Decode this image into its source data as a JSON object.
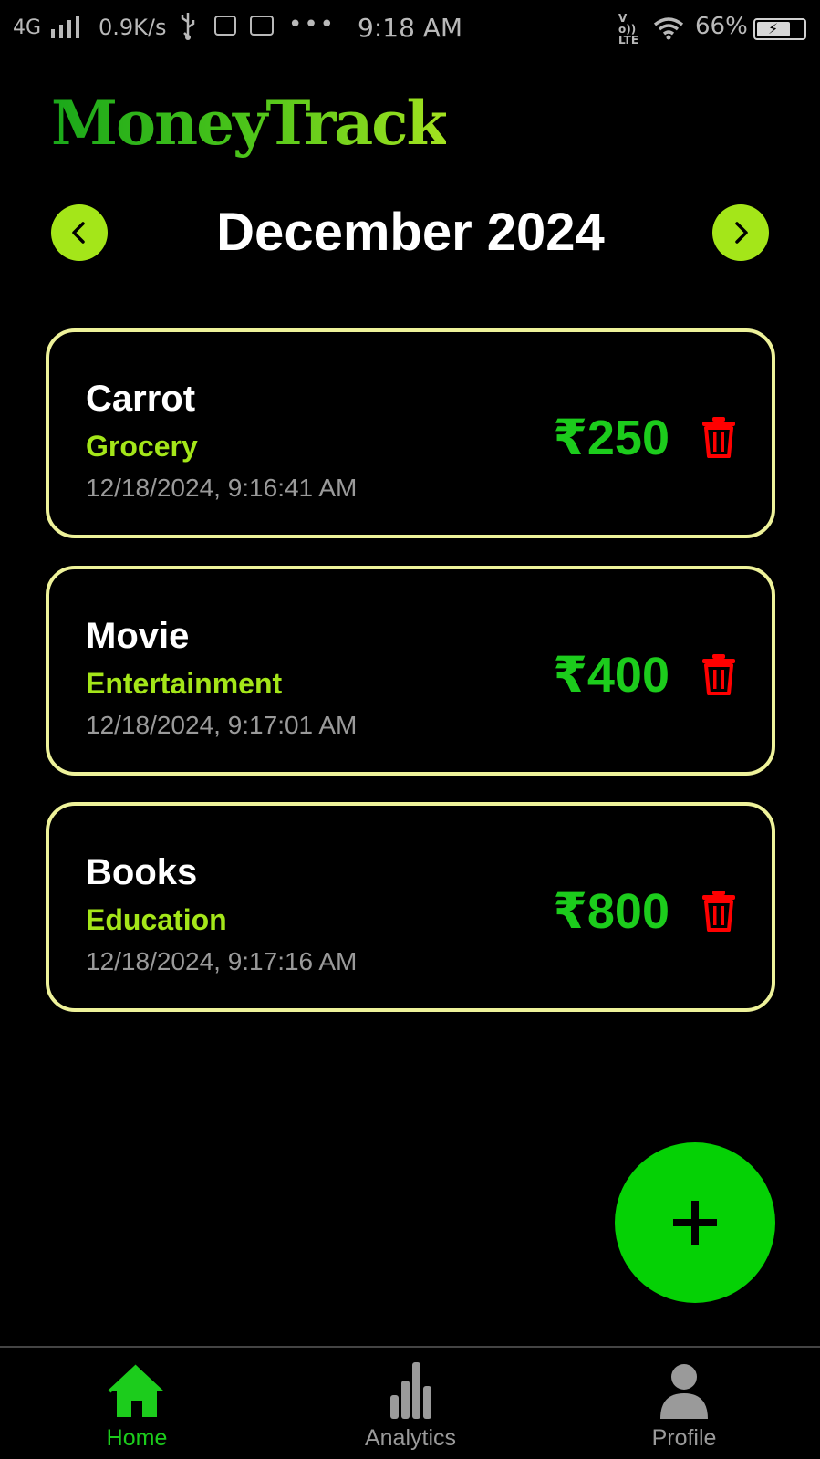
{
  "status_bar": {
    "network": "4G",
    "speed": "0.9K/s",
    "dots": "•••",
    "time": "9:18 AM",
    "volte": "Vo)) LTE",
    "battery": "66%"
  },
  "header": {
    "app_title": "MoneyTrack",
    "month": "December 2024"
  },
  "expenses": [
    {
      "title": "Carrot",
      "category": "Grocery",
      "date": "12/18/2024, 9:16:41 AM",
      "amount": "₹250"
    },
    {
      "title": "Movie",
      "category": "Entertainment",
      "date": "12/18/2024, 9:17:01 AM",
      "amount": "₹400"
    },
    {
      "title": "Books",
      "category": "Education",
      "date": "12/18/2024, 9:17:16 AM",
      "amount": "₹800"
    }
  ],
  "bottom_nav": {
    "home": "Home",
    "analytics": "Analytics",
    "profile": "Profile"
  },
  "colors": {
    "accent_lime": "#a4e619",
    "amount_green": "#1ccc1c",
    "fab_green": "#05d105",
    "card_border": "#eef29a",
    "delete_red": "#ff0000"
  },
  "icons": {
    "prev": "chevron-left-icon",
    "next": "chevron-right-icon",
    "delete": "trash-icon",
    "fab": "plus-icon",
    "home": "home-icon",
    "analytics": "bar-chart-icon",
    "profile": "user-icon"
  }
}
